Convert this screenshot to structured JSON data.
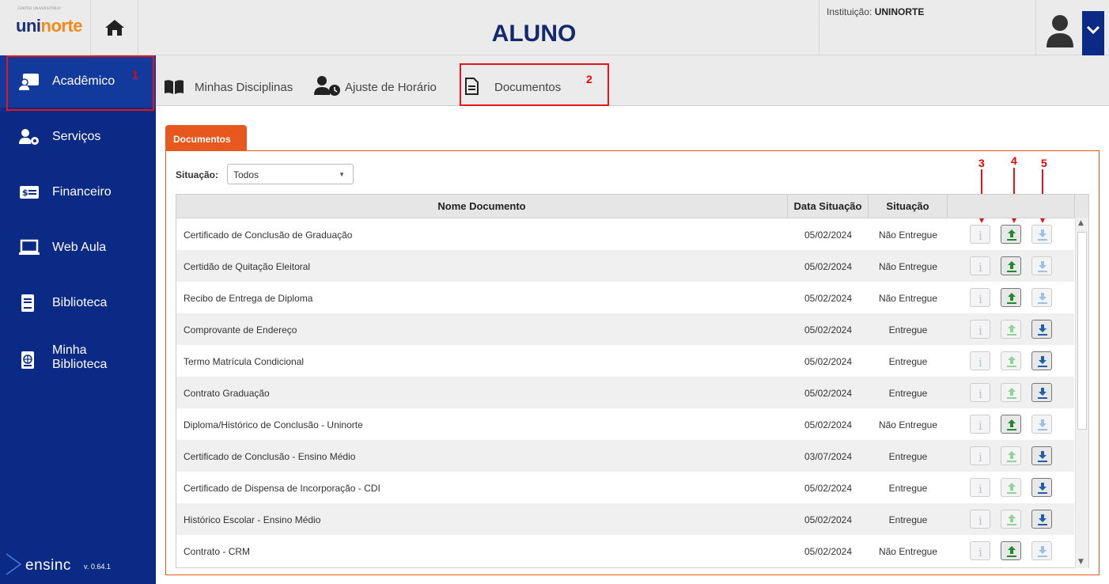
{
  "header": {
    "logo_small": "CENTRO UNIVERSITÁRIO",
    "logo_a": "uni",
    "logo_b": "norte",
    "title": "ALUNO",
    "institution_label": "Instituição:",
    "institution_value": "UNINORTE"
  },
  "sidebar": {
    "items": [
      {
        "label": "Acadêmico",
        "icon": "teacher-board-icon",
        "active": true
      },
      {
        "label": "Serviços",
        "icon": "user-gear-icon"
      },
      {
        "label": "Financeiro",
        "icon": "money-icon"
      },
      {
        "label": "Web Aula",
        "icon": "laptop-icon"
      },
      {
        "label": "Biblioteca",
        "icon": "book-icon"
      },
      {
        "label_line1": "Minha",
        "label_line2": "Biblioteca",
        "icon": "globe-book-icon"
      }
    ],
    "footer_brand": "ensinc",
    "footer_version": "v. 0.64.1"
  },
  "subnav": {
    "tabs": [
      {
        "label": "Minhas Disciplinas",
        "icon": "book-open-icon"
      },
      {
        "label": "Ajuste de Horário",
        "icon": "user-clock-icon"
      },
      {
        "label": "Documentos",
        "icon": "document-icon",
        "active": true
      }
    ]
  },
  "annotations": [
    "1",
    "2",
    "3",
    "4",
    "5"
  ],
  "panel": {
    "tab_label": "Documentos",
    "filter_label": "Situação:",
    "filter_value": "Todos"
  },
  "table": {
    "headers": [
      "Nome Documento",
      "Data Situação",
      "Situação"
    ],
    "rows": [
      {
        "name": "Certificado de Conclusão de Graduação",
        "date": "05/02/2024",
        "status": "Não Entregue"
      },
      {
        "name": "Certidão de Quitação Eleitoral",
        "date": "05/02/2024",
        "status": "Não Entregue"
      },
      {
        "name": "Recibo de Entrega de Diploma",
        "date": "05/02/2024",
        "status": "Não Entregue"
      },
      {
        "name": "Comprovante de Endereço",
        "date": "05/02/2024",
        "status": "Entregue"
      },
      {
        "name": "Termo Matrícula Condicional",
        "date": "05/02/2024",
        "status": "Entregue"
      },
      {
        "name": "Contrato Graduação",
        "date": "05/02/2024",
        "status": "Entregue"
      },
      {
        "name": "Diploma/Histórico de Conclusão - Uninorte",
        "date": "05/02/2024",
        "status": "Não Entregue"
      },
      {
        "name": "Certificado de Conclusão - Ensino Médio",
        "date": "03/07/2024",
        "status": "Entregue"
      },
      {
        "name": "Certificado de Dispensa de Incorporação - CDI",
        "date": "05/02/2024",
        "status": "Entregue"
      },
      {
        "name": "Histórico Escolar - Ensino Médio",
        "date": "05/02/2024",
        "status": "Entregue"
      },
      {
        "name": "Contrato - CRM",
        "date": "05/02/2024",
        "status": "Não Entregue"
      }
    ]
  },
  "colors": {
    "sidebar": "#0b2a86",
    "accent": "#e8571e",
    "annotation": "#e8141c",
    "upload": "#1e8a2c",
    "download": "#1f5ea8"
  }
}
